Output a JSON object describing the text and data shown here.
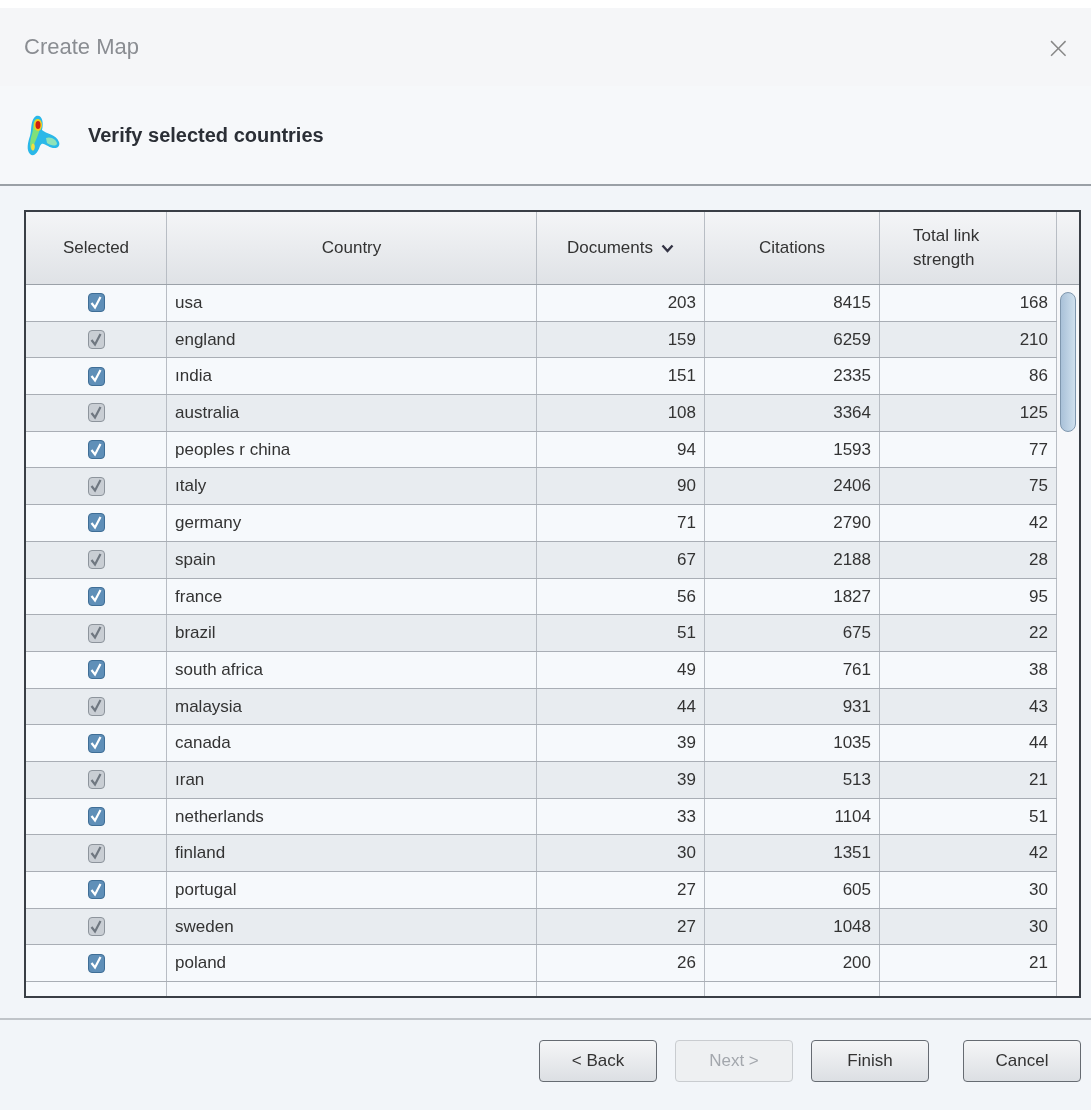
{
  "window": {
    "title": "Create Map",
    "close": "×"
  },
  "heading": "Verify selected countries",
  "table": {
    "columns": [
      {
        "label": "Selected",
        "sorted": false
      },
      {
        "label": "Country",
        "sorted": false
      },
      {
        "label": "Documents",
        "sorted": true
      },
      {
        "label": "Citations",
        "sorted": false
      },
      {
        "label": "Total link strength",
        "sorted": false
      }
    ],
    "rows": [
      {
        "checked": true,
        "country": "usa",
        "documents": "203",
        "citations": "8415",
        "total_link_strength": "168"
      },
      {
        "checked": true,
        "country": "england",
        "documents": "159",
        "citations": "6259",
        "total_link_strength": "210"
      },
      {
        "checked": true,
        "country": "ındia",
        "documents": "151",
        "citations": "2335",
        "total_link_strength": "86"
      },
      {
        "checked": true,
        "country": "australia",
        "documents": "108",
        "citations": "3364",
        "total_link_strength": "125"
      },
      {
        "checked": true,
        "country": "peoples r china",
        "documents": "94",
        "citations": "1593",
        "total_link_strength": "77"
      },
      {
        "checked": true,
        "country": "ıtaly",
        "documents": "90",
        "citations": "2406",
        "total_link_strength": "75"
      },
      {
        "checked": true,
        "country": "germany",
        "documents": "71",
        "citations": "2790",
        "total_link_strength": "42"
      },
      {
        "checked": true,
        "country": "spain",
        "documents": "67",
        "citations": "2188",
        "total_link_strength": "28"
      },
      {
        "checked": true,
        "country": "france",
        "documents": "56",
        "citations": "1827",
        "total_link_strength": "95"
      },
      {
        "checked": true,
        "country": "brazil",
        "documents": "51",
        "citations": "675",
        "total_link_strength": "22"
      },
      {
        "checked": true,
        "country": "south africa",
        "documents": "49",
        "citations": "761",
        "total_link_strength": "38"
      },
      {
        "checked": true,
        "country": "malaysia",
        "documents": "44",
        "citations": "931",
        "total_link_strength": "43"
      },
      {
        "checked": true,
        "country": "canada",
        "documents": "39",
        "citations": "1035",
        "total_link_strength": "44"
      },
      {
        "checked": true,
        "country": "ıran",
        "documents": "39",
        "citations": "513",
        "total_link_strength": "21"
      },
      {
        "checked": true,
        "country": "netherlands",
        "documents": "33",
        "citations": "1104",
        "total_link_strength": "51"
      },
      {
        "checked": true,
        "country": "finland",
        "documents": "30",
        "citations": "1351",
        "total_link_strength": "42"
      },
      {
        "checked": true,
        "country": "portugal",
        "documents": "27",
        "citations": "605",
        "total_link_strength": "30"
      },
      {
        "checked": true,
        "country": "sweden",
        "documents": "27",
        "citations": "1048",
        "total_link_strength": "30"
      },
      {
        "checked": true,
        "country": "poland",
        "documents": "26",
        "citations": "200",
        "total_link_strength": "21"
      }
    ]
  },
  "buttons": [
    {
      "label": "< Back",
      "disabled": false
    },
    {
      "label": "Next >",
      "disabled": true
    },
    {
      "label": "Finish",
      "disabled": false
    },
    {
      "label": "Cancel",
      "disabled": false
    }
  ]
}
